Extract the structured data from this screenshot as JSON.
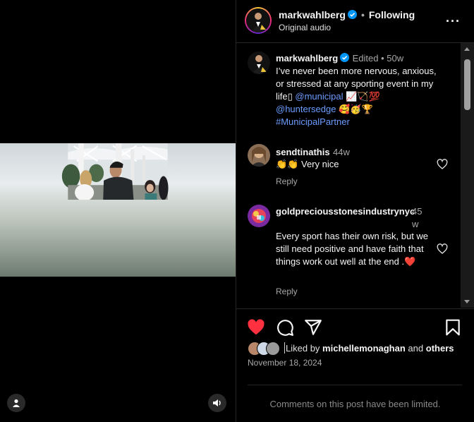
{
  "header": {
    "username": "markwahlberg",
    "follow_status": "Following",
    "audio_label": "Original audio",
    "more_icon": "more-horizontal-icon"
  },
  "caption": {
    "username": "markwahlberg",
    "edited": "Edited",
    "time": "50w",
    "text_part1": "I’ve never been more nervous, anxious, or stressed at any sporting event in my life",
    "mention1": "@municipal",
    "emojis1": "📈🏹💯",
    "mention2": "@huntersedge",
    "emojis2": "🥰🥳🏆",
    "hashtag": "#MunicipalPartner"
  },
  "comments": [
    {
      "username": "sendtinathis",
      "time": "44w",
      "text": "👏👏 Very nice",
      "reply_label": "Reply"
    },
    {
      "username": "goldpreciousstonesindustrynyc",
      "time": "45w",
      "text": "Every sport has their own risk, but we still need positive and have faith that things work out well at the end .❤️",
      "reply_label": "Reply"
    }
  ],
  "actions": {
    "like_icon": "heart-filled-icon",
    "comment_icon": "comment-icon",
    "share_icon": "share-icon",
    "save_icon": "bookmark-icon",
    "liked_by_prefix": "Liked by",
    "liked_by_user": "michellemonaghan",
    "liked_by_and": "and",
    "liked_by_others": "others",
    "date": "November 18, 2024"
  },
  "limited_notice": "Comments on this post have been limited.",
  "colors": {
    "like_red": "#ff3040",
    "link_blue": "#6b9cff",
    "verified_blue": "#0095f6",
    "background": "#000000"
  }
}
